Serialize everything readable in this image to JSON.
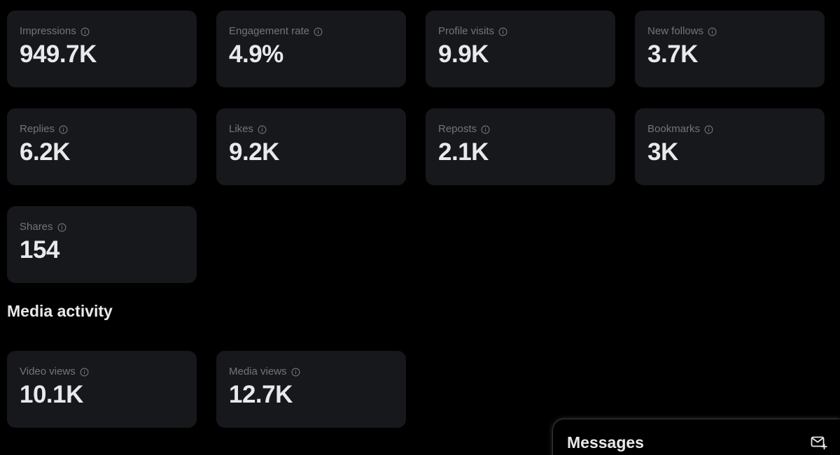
{
  "metrics": [
    {
      "label": "Impressions",
      "value": "949.7K"
    },
    {
      "label": "Engagement rate",
      "value": "4.9%"
    },
    {
      "label": "Profile visits",
      "value": "9.9K"
    },
    {
      "label": "New follows",
      "value": "3.7K"
    },
    {
      "label": "Replies",
      "value": "6.2K"
    },
    {
      "label": "Likes",
      "value": "9.2K"
    },
    {
      "label": "Reposts",
      "value": "2.1K"
    },
    {
      "label": "Bookmarks",
      "value": "3K"
    },
    {
      "label": "Shares",
      "value": "154"
    }
  ],
  "media_section": {
    "title": "Media activity",
    "metrics": [
      {
        "label": "Video views",
        "value": "10.1K"
      },
      {
        "label": "Media views",
        "value": "12.7K"
      }
    ]
  },
  "messages": {
    "title": "Messages",
    "compose_icon": "new-message-icon"
  },
  "colors": {
    "background": "#000000",
    "card": "#16181c",
    "label": "#71767b",
    "value": "#e7e9ea"
  }
}
